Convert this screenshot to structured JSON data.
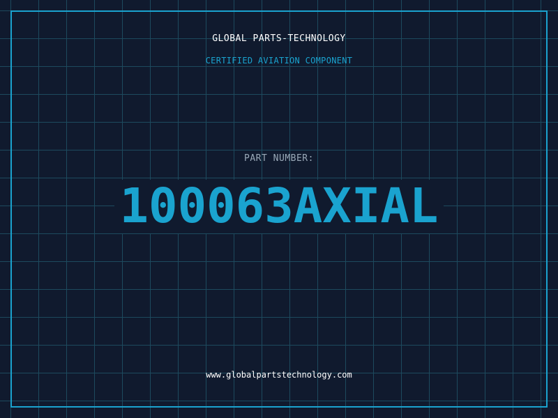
{
  "header": {
    "company": "GLOBAL PARTS-TECHNOLOGY",
    "tagline": "CERTIFIED AVIATION COMPONENT"
  },
  "part": {
    "label": "PART NUMBER:",
    "number": "100063AXIAL"
  },
  "footer": {
    "website": "www.globalpartstechnology.com"
  },
  "colors": {
    "background": "#101a2e",
    "grid": "#1d4a5e",
    "accent": "#1aa3cf",
    "text": "#ffffff",
    "muted": "#9aa9b8"
  }
}
